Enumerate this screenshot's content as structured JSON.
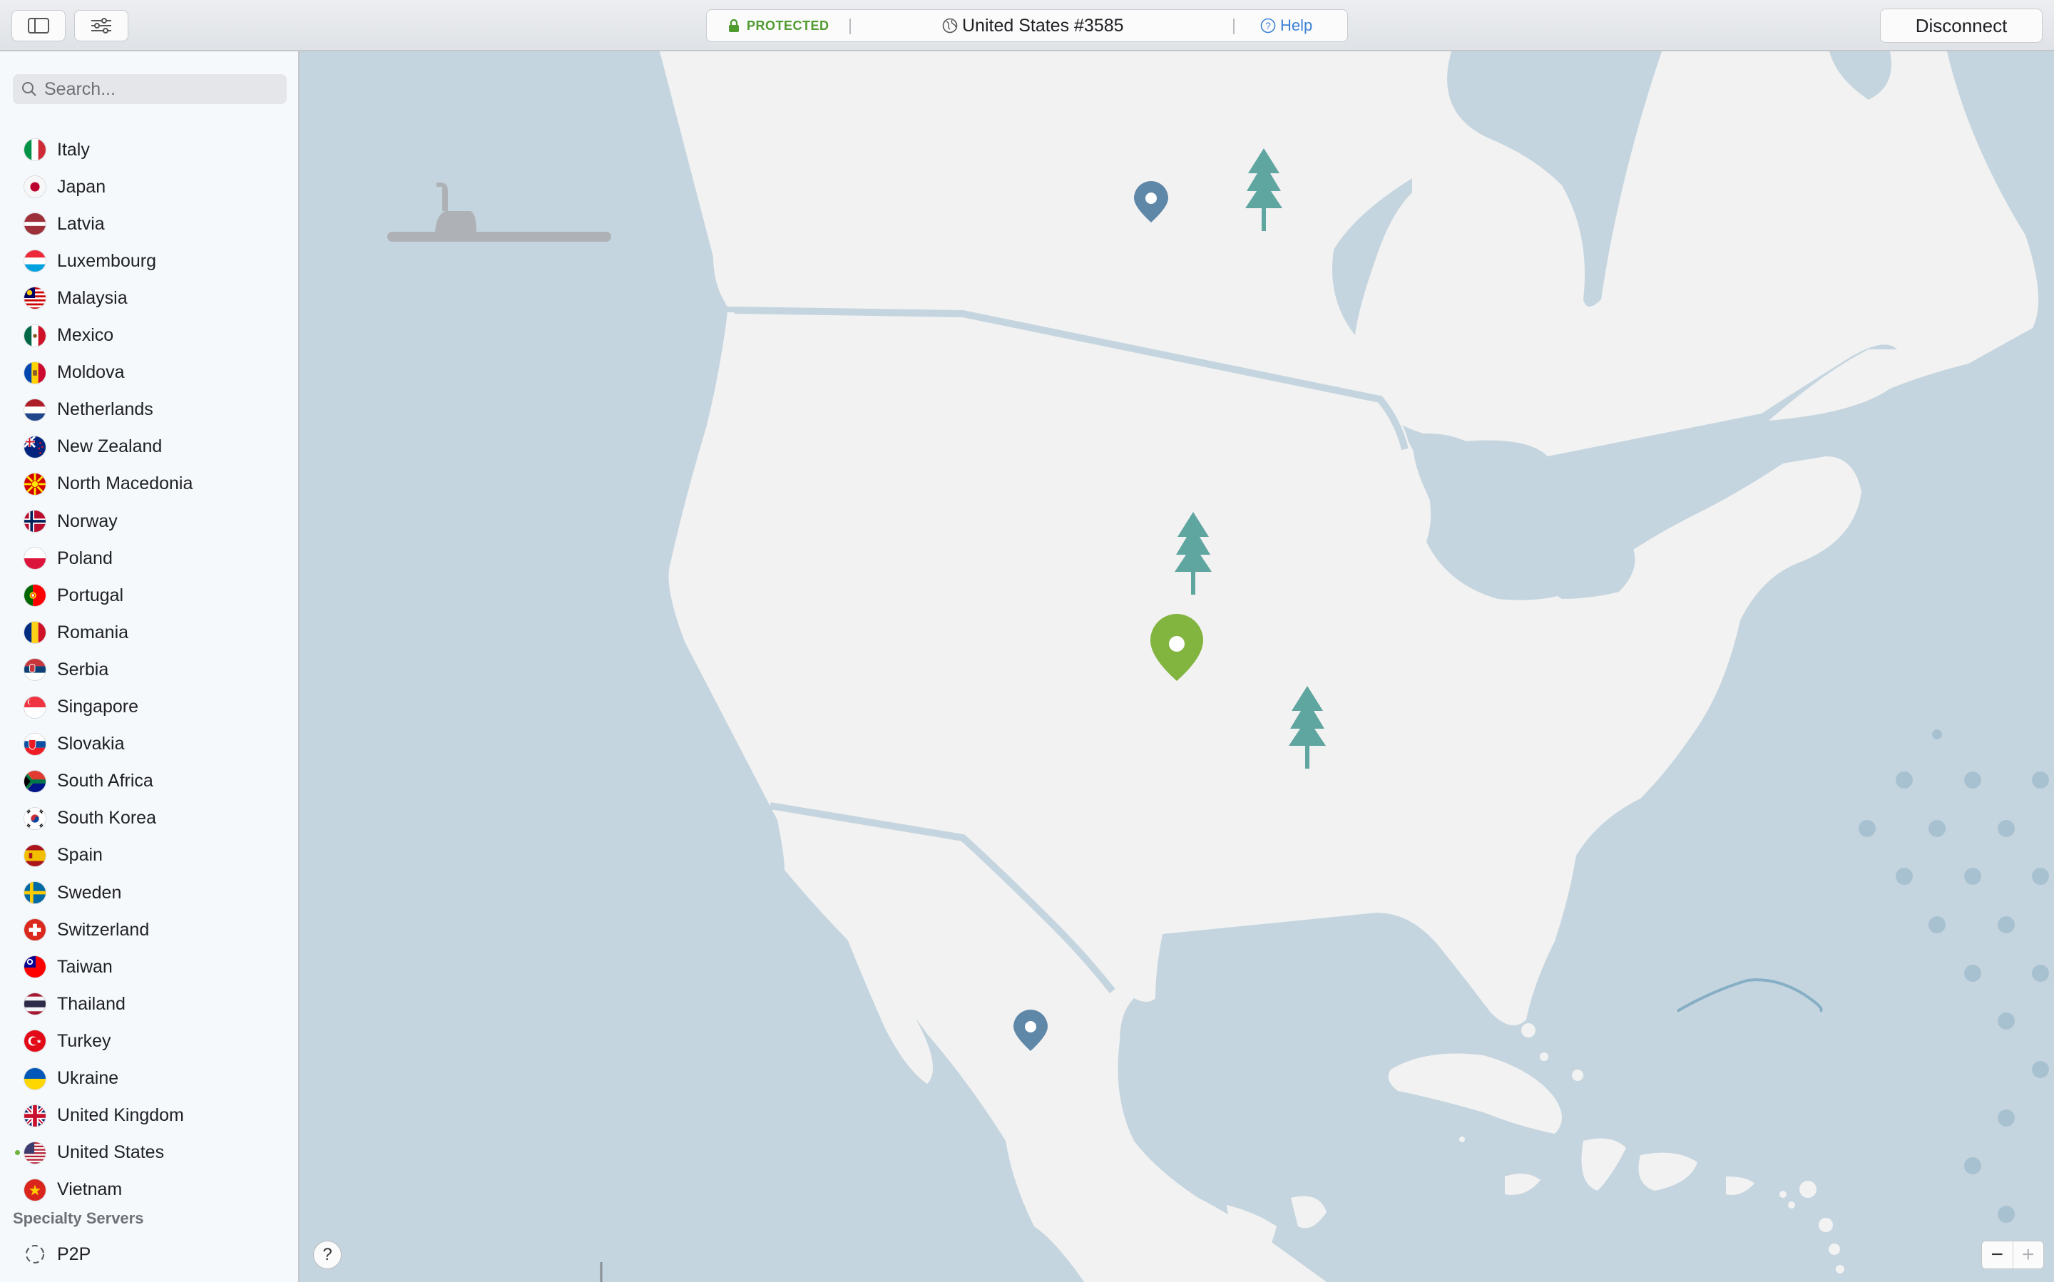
{
  "toolbar": {
    "sidebar_toggle_icon": "sidebar-icon",
    "settings_icon": "sliders-icon",
    "status": {
      "protected_label": "PROTECTED",
      "server_name": "United States #3585",
      "help_label": "Help"
    },
    "disconnect_label": "Disconnect"
  },
  "sidebar": {
    "search_placeholder": "Search...",
    "countries": [
      {
        "name": "Italy",
        "flag": "italy"
      },
      {
        "name": "Japan",
        "flag": "japan"
      },
      {
        "name": "Latvia",
        "flag": "latvia"
      },
      {
        "name": "Luxembourg",
        "flag": "luxembourg"
      },
      {
        "name": "Malaysia",
        "flag": "malaysia"
      },
      {
        "name": "Mexico",
        "flag": "mexico"
      },
      {
        "name": "Moldova",
        "flag": "moldova"
      },
      {
        "name": "Netherlands",
        "flag": "netherlands"
      },
      {
        "name": "New Zealand",
        "flag": "new-zealand"
      },
      {
        "name": "North Macedonia",
        "flag": "north-macedonia"
      },
      {
        "name": "Norway",
        "flag": "norway"
      },
      {
        "name": "Poland",
        "flag": "poland"
      },
      {
        "name": "Portugal",
        "flag": "portugal"
      },
      {
        "name": "Romania",
        "flag": "romania"
      },
      {
        "name": "Serbia",
        "flag": "serbia"
      },
      {
        "name": "Singapore",
        "flag": "singapore"
      },
      {
        "name": "Slovakia",
        "flag": "slovakia"
      },
      {
        "name": "South Africa",
        "flag": "south-africa"
      },
      {
        "name": "South Korea",
        "flag": "south-korea"
      },
      {
        "name": "Spain",
        "flag": "spain"
      },
      {
        "name": "Sweden",
        "flag": "sweden"
      },
      {
        "name": "Switzerland",
        "flag": "switzerland"
      },
      {
        "name": "Taiwan",
        "flag": "taiwan"
      },
      {
        "name": "Thailand",
        "flag": "thailand"
      },
      {
        "name": "Turkey",
        "flag": "turkey"
      },
      {
        "name": "Ukraine",
        "flag": "ukraine"
      },
      {
        "name": "United Kingdom",
        "flag": "united-kingdom"
      },
      {
        "name": "United States",
        "flag": "united-states",
        "connected": true
      },
      {
        "name": "Vietnam",
        "flag": "vietnam"
      }
    ],
    "specialty_title": "Specialty Servers",
    "specialty": [
      {
        "name": "P2P",
        "icon": "p2p-icon"
      }
    ]
  },
  "map": {
    "help_button_label": "?",
    "zoom_out_label": "−",
    "zoom_in_label": "+"
  },
  "colors": {
    "water": "#c5d5df",
    "land": "#f2f2f2",
    "connected_pin": "#82b440",
    "server_pin": "#5f87a8",
    "tree": "#5fa5a0",
    "protected_green": "#4f9b2f",
    "help_blue": "#3b82d6"
  }
}
